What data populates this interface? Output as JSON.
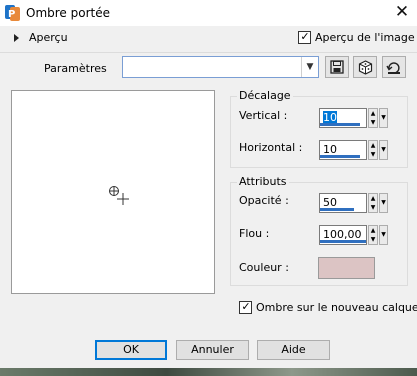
{
  "window": {
    "title": "Ombre portée",
    "close_glyph": "✕"
  },
  "preview": {
    "toggle_label": "Aperçu",
    "checkbox_label": "Aperçu de l'image",
    "checked": true
  },
  "params": {
    "label": "Paramètres",
    "value": ""
  },
  "decalage": {
    "title": "Décalage",
    "vertical_label": "Vertical :",
    "vertical_value": "10",
    "horizontal_label": "Horizontal :",
    "horizontal_value": "10"
  },
  "attributs": {
    "title": "Attributs",
    "opacite_label": "Opacité :",
    "opacite_value": "50",
    "flou_label": "Flou :",
    "flou_value": "100,00",
    "couleur_label": "Couleur :",
    "couleur_color": "#dcc4c4"
  },
  "shadow_new_layer": {
    "label": "Ombre sur le nouveau calque",
    "checked": true
  },
  "buttons": {
    "ok": "OK",
    "cancel": "Annuler",
    "help": "Aide"
  },
  "colors": {
    "accent": "#0078d7",
    "slider_fill": "#2f6fbf"
  },
  "icons": {
    "app": "psp-app-icon",
    "save": "save-icon",
    "random": "dice-icon",
    "reset": "reset-icon",
    "crosshair": "crosshair-icon"
  }
}
